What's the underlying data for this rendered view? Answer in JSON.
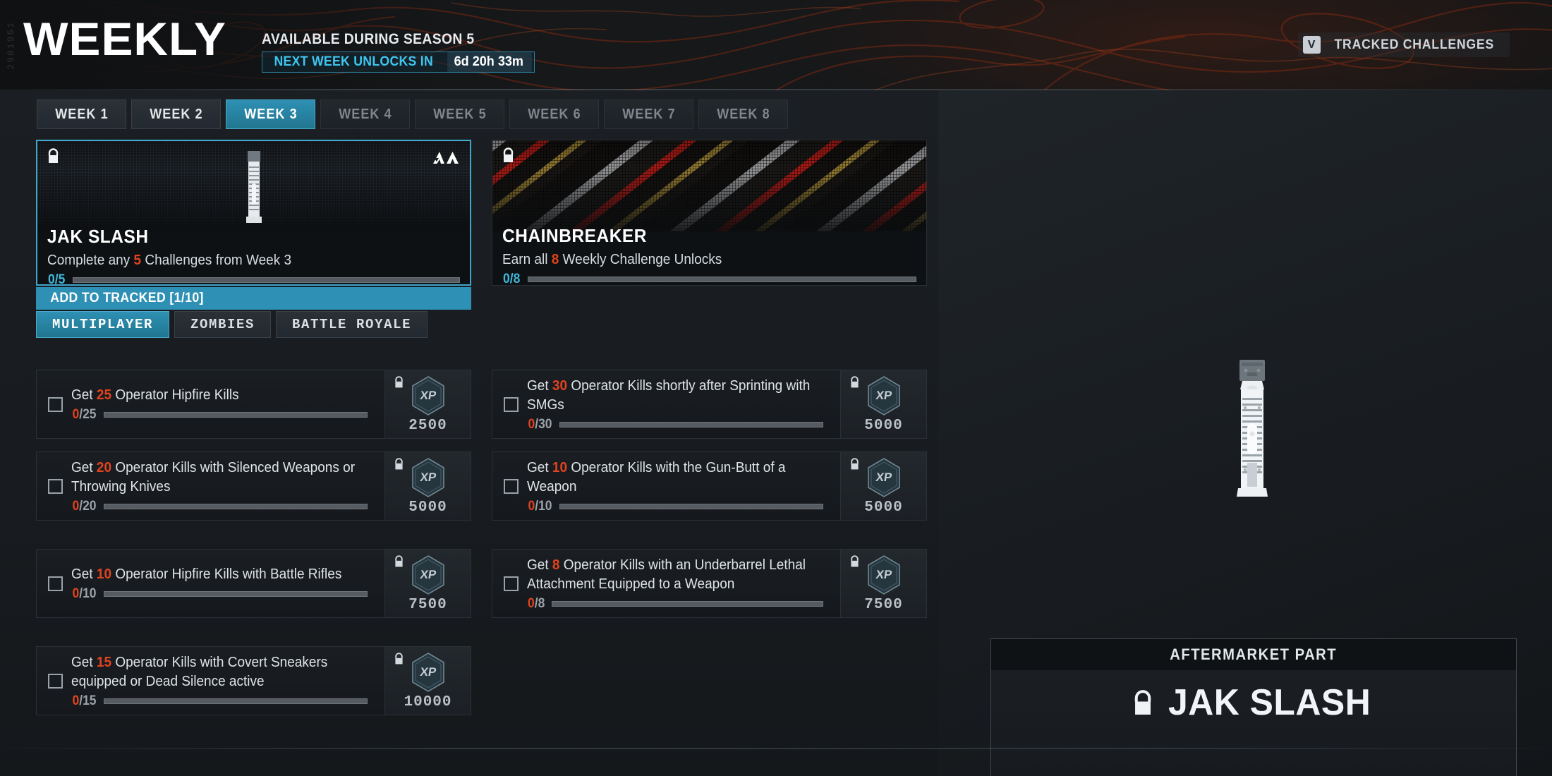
{
  "header": {
    "side_code": "2981951",
    "title": "WEEKLY",
    "season_text": "AVAILABLE DURING SEASON 5",
    "unlock_label": "NEXT WEEK UNLOCKS IN",
    "unlock_time": "6d 20h 33m",
    "tracked_key": "V",
    "tracked_label": "TRACKED CHALLENGES"
  },
  "week_tabs": [
    {
      "label": "WEEK 1",
      "state": "available"
    },
    {
      "label": "WEEK 2",
      "state": "available"
    },
    {
      "label": "WEEK 3",
      "state": "active"
    },
    {
      "label": "WEEK 4",
      "state": "locked"
    },
    {
      "label": "WEEK 5",
      "state": "locked"
    },
    {
      "label": "WEEK 6",
      "state": "locked"
    },
    {
      "label": "WEEK 7",
      "state": "locked"
    },
    {
      "label": "WEEK 8",
      "state": "locked"
    }
  ],
  "reward_cards": [
    {
      "name": "JAK SLASH",
      "desc_pre": "Complete any ",
      "desc_hl": "5",
      "desc_post": " Challenges from Week 3",
      "progress_text": "0/5",
      "progress_pct": 0,
      "lock_icon": "lock-icon",
      "brand_icon": "aftermarket-part-logo",
      "art": "weapon-render",
      "track_label": "ADD TO TRACKED [1/10]",
      "selected": true
    },
    {
      "name": "CHAINBREAKER",
      "desc_pre": "Earn all ",
      "desc_hl": "8",
      "desc_post": " Weekly Challenge Unlocks",
      "progress_text": "0/8",
      "progress_pct": 0,
      "lock_icon": "lock-icon",
      "brand_icon": "",
      "art": "camo-stripes",
      "track_label": "",
      "selected": false
    }
  ],
  "mode_tabs": [
    {
      "label": "MULTIPLAYER",
      "active": true
    },
    {
      "label": "ZOMBIES",
      "active": false
    },
    {
      "label": "BATTLE ROYALE",
      "active": false
    }
  ],
  "challenges_left": [
    {
      "desc_pre": "Get ",
      "desc_hl": "25",
      "desc_post": " Operator Hipfire Kills",
      "current": "0",
      "target": "/25",
      "progress_pct": 0,
      "xp": "2500"
    },
    {
      "desc_pre": "Get ",
      "desc_hl": "20",
      "desc_post": " Operator Kills with Silenced Weapons or Throwing Knives",
      "current": "0",
      "target": "/20",
      "progress_pct": 0,
      "xp": "5000"
    },
    {
      "desc_pre": "Get ",
      "desc_hl": "10",
      "desc_post": " Operator Hipfire Kills with Battle Rifles",
      "current": "0",
      "target": "/10",
      "progress_pct": 0,
      "xp": "7500"
    },
    {
      "desc_pre": "Get ",
      "desc_hl": "15",
      "desc_post": " Operator Kills with Covert Sneakers equipped or Dead Silence active",
      "current": "0",
      "target": "/15",
      "progress_pct": 0,
      "xp": "10000"
    }
  ],
  "challenges_right": [
    {
      "desc_pre": "Get ",
      "desc_hl": "30",
      "desc_post": " Operator Kills shortly after Sprinting with SMGs",
      "current": "0",
      "target": "/30",
      "progress_pct": 0,
      "xp": "5000"
    },
    {
      "desc_pre": "Get ",
      "desc_hl": "10",
      "desc_post": " Operator Kills with the Gun-Butt of a Weapon",
      "current": "0",
      "target": "/10",
      "progress_pct": 0,
      "xp": "5000"
    },
    {
      "desc_pre": "Get ",
      "desc_hl": "8",
      "desc_post": " Operator Kills with an Underbarrel Lethal Attachment Equipped to a Weapon",
      "current": "0",
      "target": "/8",
      "progress_pct": 0,
      "xp": "7500"
    }
  ],
  "preview": {
    "category": "AFTERMARKET PART",
    "item_name": "JAK SLASH",
    "lock_icon": "lock-icon"
  },
  "colors": {
    "accent_cyan": "#2e90b4",
    "accent_cyan_text": "#3fc6f0",
    "highlight_orange": "#e0431f",
    "panel_bg": "#1a1e22",
    "page_bg": "#15181b"
  }
}
